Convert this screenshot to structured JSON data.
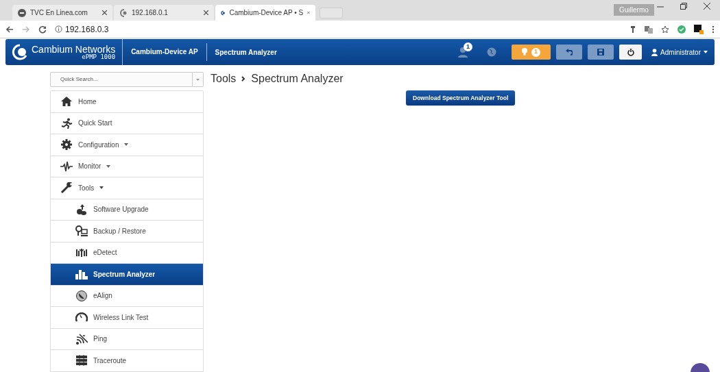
{
  "browser": {
    "tabs": [
      {
        "title": "TVC En Linea.com",
        "selected": false
      },
      {
        "title": "192.168.0.1",
        "selected": false
      },
      {
        "title": "Cambium-Device AP • S",
        "selected": true
      }
    ],
    "profile": "Guillermo",
    "address": "192.168.0.3"
  },
  "header": {
    "brand": "Cambium Networks",
    "model": "ePMP 1000",
    "device": "Cambium-Device AP",
    "page": "Spectrum Analyzer",
    "user_badge": "1",
    "alert_count": "1",
    "user": "Administrator"
  },
  "sidebar": {
    "search_placeholder": "Quick Search...",
    "items": [
      {
        "label": "Home",
        "selected": false
      },
      {
        "label": "Quick Start",
        "selected": false
      },
      {
        "label": "Configuration",
        "selected": false,
        "expanded": false
      },
      {
        "label": "Monitor",
        "selected": false,
        "expanded": false
      },
      {
        "label": "Tools",
        "selected": false,
        "expanded": true,
        "children": [
          {
            "label": "Software Upgrade",
            "selected": false
          },
          {
            "label": "Backup / Restore",
            "selected": false
          },
          {
            "label": "eDetect",
            "selected": false
          },
          {
            "label": "Spectrum Analyzer",
            "selected": true
          },
          {
            "label": "eAlign",
            "selected": false
          },
          {
            "label": "Wireless Link Test",
            "selected": false
          },
          {
            "label": "Ping",
            "selected": false
          },
          {
            "label": "Traceroute",
            "selected": false
          }
        ]
      }
    ]
  },
  "breadcrumb": [
    "Tools",
    "Spectrum Analyzer"
  ],
  "download_button": "Download Spectrum Analyzer Tool"
}
